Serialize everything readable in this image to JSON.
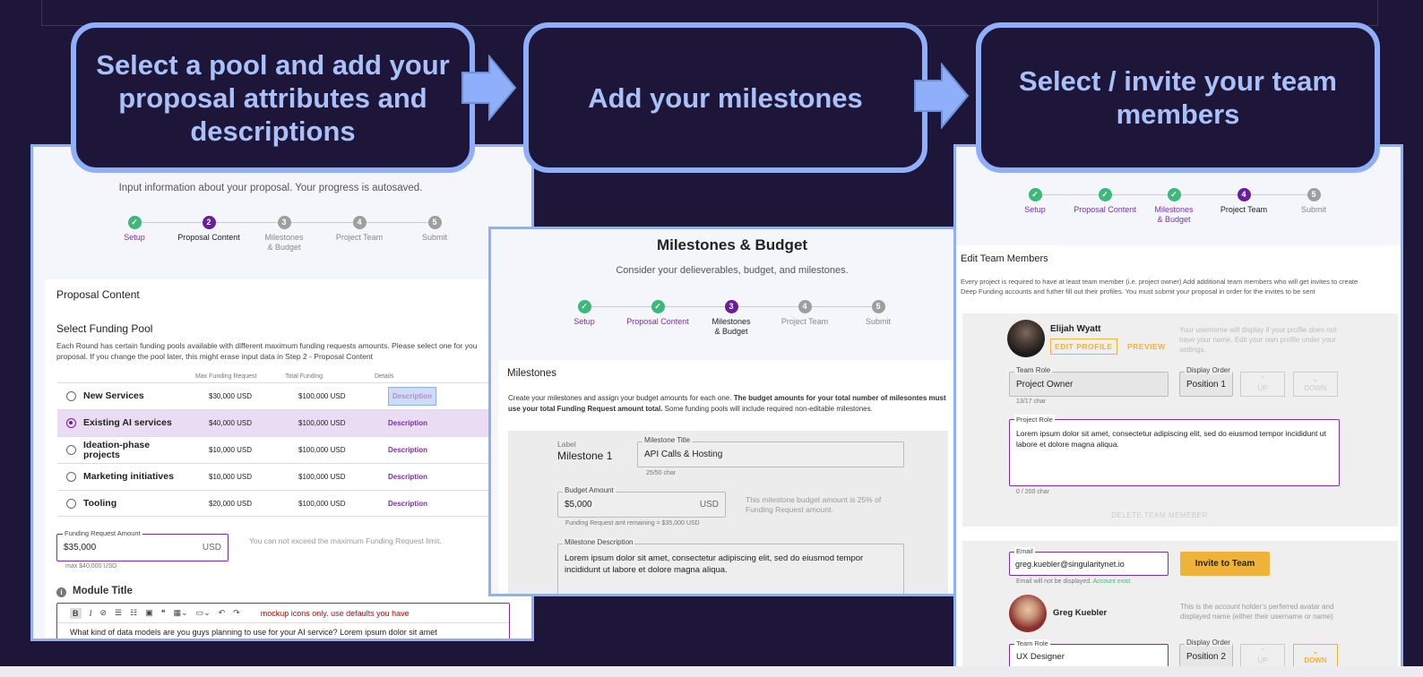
{
  "callouts": [
    {
      "text": "Select a pool and add your proposal attributes and descriptions"
    },
    {
      "text": "Add your milestones"
    },
    {
      "text": "Select / invite your team members"
    }
  ],
  "colors": {
    "background": "#1d1638",
    "callout_border": "#8faffa",
    "callout_text": "#a9c0f8",
    "purple": "#6b1e99",
    "green": "#3cb878",
    "orange": "#f0b33a"
  },
  "steps": [
    "Setup",
    "Proposal Content",
    "Milestones & Budget",
    "Project Team",
    "Submit"
  ],
  "panel1": {
    "intro": "Input information about your proposal.  Your progress is autosaved.",
    "section_title": "Proposal Content",
    "pool_title": "Select Funding Pool",
    "pool_desc": "Each Round has certain funding pools available with different maximum funding requests amounts.  Please select one for you proposal.   If you change the pool later, this might erase input data in Step 2 - Proposal Content",
    "headers": [
      "Max Funding Request",
      "Total Funding",
      "Details"
    ],
    "pools": [
      {
        "name": "New Services",
        "max": "$30,000 USD",
        "total": "$100,000 USD",
        "details": "Description",
        "selected": false
      },
      {
        "name": "Existing AI services",
        "max": "$40,000 USD",
        "total": "$100,000 USD",
        "details": "Description",
        "selected": true
      },
      {
        "name": "Ideation-phase projects",
        "max": "$10,000 USD",
        "total": "$100,000 USD",
        "details": "Description",
        "selected": false
      },
      {
        "name": "Marketing initiatives",
        "max": "$10,000 USD",
        "total": "$100,000 USD",
        "details": "Description",
        "selected": false
      },
      {
        "name": "Tooling",
        "max": "$20,000 USD",
        "total": "$100,000 USD",
        "details": "Description",
        "selected": false
      }
    ],
    "funding_label": "Funding Request Amount",
    "funding_value": "$35,000",
    "funding_unit": "USD",
    "funding_max": "max $40,000 USD",
    "funding_note": "You can not exceed the maximum Funding Request limit.",
    "module_title": "Module Title",
    "toolbar_warning": "mockup icons only. use defaults you have",
    "editor_text": "What kind of data models are you guys planning to use for your AI service? Lorem ipsum dolor sit amet"
  },
  "panel2": {
    "title": "Milestones & Budget",
    "subtitle": "Consider your delieverables, budget, and milestones.",
    "section": "Milestones",
    "desc_normal": "Create your milestones and assign your budget amounts for each one.  ",
    "desc_bold": "The budget amounts for your total number of milesontes must use your total Funding Request amount total.",
    "desc_tail": "  Some funding pools will include required non-editable milestones.",
    "label_caption": "Label",
    "milestone_label": "Milestone 1",
    "title_field_label": "Milestone Title",
    "title_value": "API Calls & Hosting",
    "title_count": "25/50 char",
    "budget_label": "Budget Amount",
    "budget_value": "$5,000",
    "budget_unit": "USD",
    "budget_remaining": "Funding Request amt remaining = $35,000 USD",
    "budget_note": "This milestone budget amount is 25% of Funding Request amount.",
    "desc_field_label": "Milestone Description",
    "desc_value": "Lorem ipsum dolor sit amet, consectetur adipiscing elit, sed do eiusmod tempor incididunt ut labore et dolore magna aliqua."
  },
  "panel3": {
    "section": "Edit Team Members",
    "desc": "Every project is required to have at least team member (i.e. project owner)  Add additional team members who will get invites to create Deep Funding accounts and futher fill out their profiles.  You must submit your proposal in order for the invites to be sent",
    "member1": {
      "name": "Elijah Wyatt",
      "edit": "EDIT PROFILE",
      "preview": "PREVIEW",
      "note": "Your usernome will display if your profile does not have your name.  Edit your own profile under your settings.",
      "role_label": "Team Role",
      "role_value": "Project Owner",
      "role_count": "13/17 char",
      "order_label": "Display Order",
      "order_value": "Position 1",
      "up": "UP",
      "down": "DOWN",
      "project_role_label": "Project Role",
      "project_role_value": "Lorem ipsum dolor sit amet, consectetur adipiscing elit, sed do eiusmod tempor incididunt ut labore et dolore magna aliqua.",
      "project_role_count": "0 / 200 char",
      "delete": "DELETE TEAM MEMEBER"
    },
    "invite": {
      "email_label": "Email",
      "email_value": "greg.kuebler@singularitynet.io",
      "button": "Invite to Team",
      "hint": "Email will not be displayed.",
      "exists": "Account exist"
    },
    "member2": {
      "name": "Greg Kuebler",
      "note": "This is the account holder's perferred avatar and displayed name (either their username or name)",
      "role_label": "Team Role",
      "role_value": "UX Designer",
      "order_label": "Display Order",
      "order_value": "Position 2",
      "up": "UP",
      "down": "DOWN"
    }
  }
}
